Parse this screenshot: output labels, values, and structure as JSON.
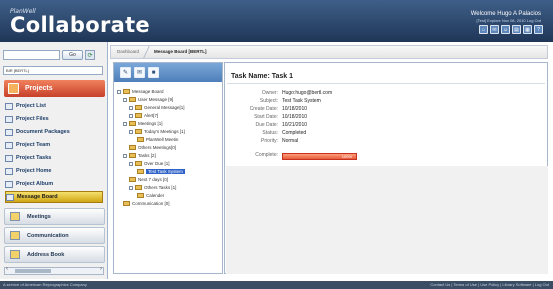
{
  "header": {
    "brand_small": "PlanWell",
    "brand_big": "Collaborate",
    "welcome": "Welcome Hugo A Palacios",
    "date": "[Test] Explore Nov 08, 2010 Log Out",
    "icons": [
      "home-icon",
      "mail-icon",
      "users-icon",
      "chart-icon",
      "print-icon",
      "help-icon"
    ]
  },
  "sidebar": {
    "search_placeholder": "",
    "go_label": "Go",
    "refresh_glyph": "⟳",
    "account_value": "BIR [BERTL]",
    "section_title": "Projects",
    "items": [
      {
        "label": "Project List",
        "active": false
      },
      {
        "label": "Project Files",
        "active": false
      },
      {
        "label": "Document Packages",
        "active": false
      },
      {
        "label": "Project Team",
        "active": false
      },
      {
        "label": "Project Tasks",
        "active": false
      },
      {
        "label": "Project Home",
        "active": false
      },
      {
        "label": "Project Album",
        "active": false
      },
      {
        "label": "Message Board",
        "active": true
      }
    ],
    "categories": [
      {
        "label": "Meetings"
      },
      {
        "label": "Communication"
      },
      {
        "label": "Address Book"
      }
    ]
  },
  "breadcrumb": {
    "home": "Dashboard",
    "current": "Message Board [BERTL]"
  },
  "tree": {
    "toolbar_glyphs": [
      "✎",
      "✉",
      "■"
    ],
    "nodes": [
      {
        "label": "Message Board",
        "depth": 0,
        "selected": false
      },
      {
        "label": "User Message [9]",
        "depth": 1,
        "selected": false
      },
      {
        "label": "General Message[1]",
        "depth": 2,
        "selected": false
      },
      {
        "label": "Alert[7]",
        "depth": 2,
        "selected": false
      },
      {
        "label": "Meetings [1]",
        "depth": 1,
        "selected": false
      },
      {
        "label": "Today's Meetings [1]",
        "depth": 2,
        "selected": false
      },
      {
        "label": "PlanWell Meetin",
        "depth": 3,
        "selected": false
      },
      {
        "label": "Others Meetings[0]",
        "depth": 2,
        "selected": false
      },
      {
        "label": "Tasks [2]",
        "depth": 1,
        "selected": false
      },
      {
        "label": "Over Due [1]",
        "depth": 2,
        "selected": false
      },
      {
        "label": "Test Task System",
        "depth": 3,
        "selected": true
      },
      {
        "label": "Next 7 days [0]",
        "depth": 2,
        "selected": false
      },
      {
        "label": "Others Tasks [1]",
        "depth": 2,
        "selected": false
      },
      {
        "label": "Calender",
        "depth": 3,
        "selected": false
      },
      {
        "label": "Communication [0]",
        "depth": 1,
        "selected": false
      }
    ]
  },
  "task": {
    "title": "Task Name: Task 1",
    "fields": [
      {
        "label": "Owner:",
        "value": "Hugo:hugo@bertl.com"
      },
      {
        "label": "Subject:",
        "value": "Test Task System"
      },
      {
        "label": "Create Date:",
        "value": "10/18/2010"
      },
      {
        "label": "Start Date:",
        "value": "10/18/2010"
      },
      {
        "label": "Due Date:",
        "value": "10/21/2010"
      },
      {
        "label": "Status:",
        "value": "Completed"
      },
      {
        "label": "Priority:",
        "value": "Normal"
      },
      {
        "label": "Complete:",
        "value": ""
      }
    ],
    "complete_percent": 100,
    "complete_text": "100%"
  },
  "footer": {
    "left": "A service of American Reprographics Company",
    "right": "Contact Us | Terms of Use | Use Policy | Library Software | Log Out"
  }
}
